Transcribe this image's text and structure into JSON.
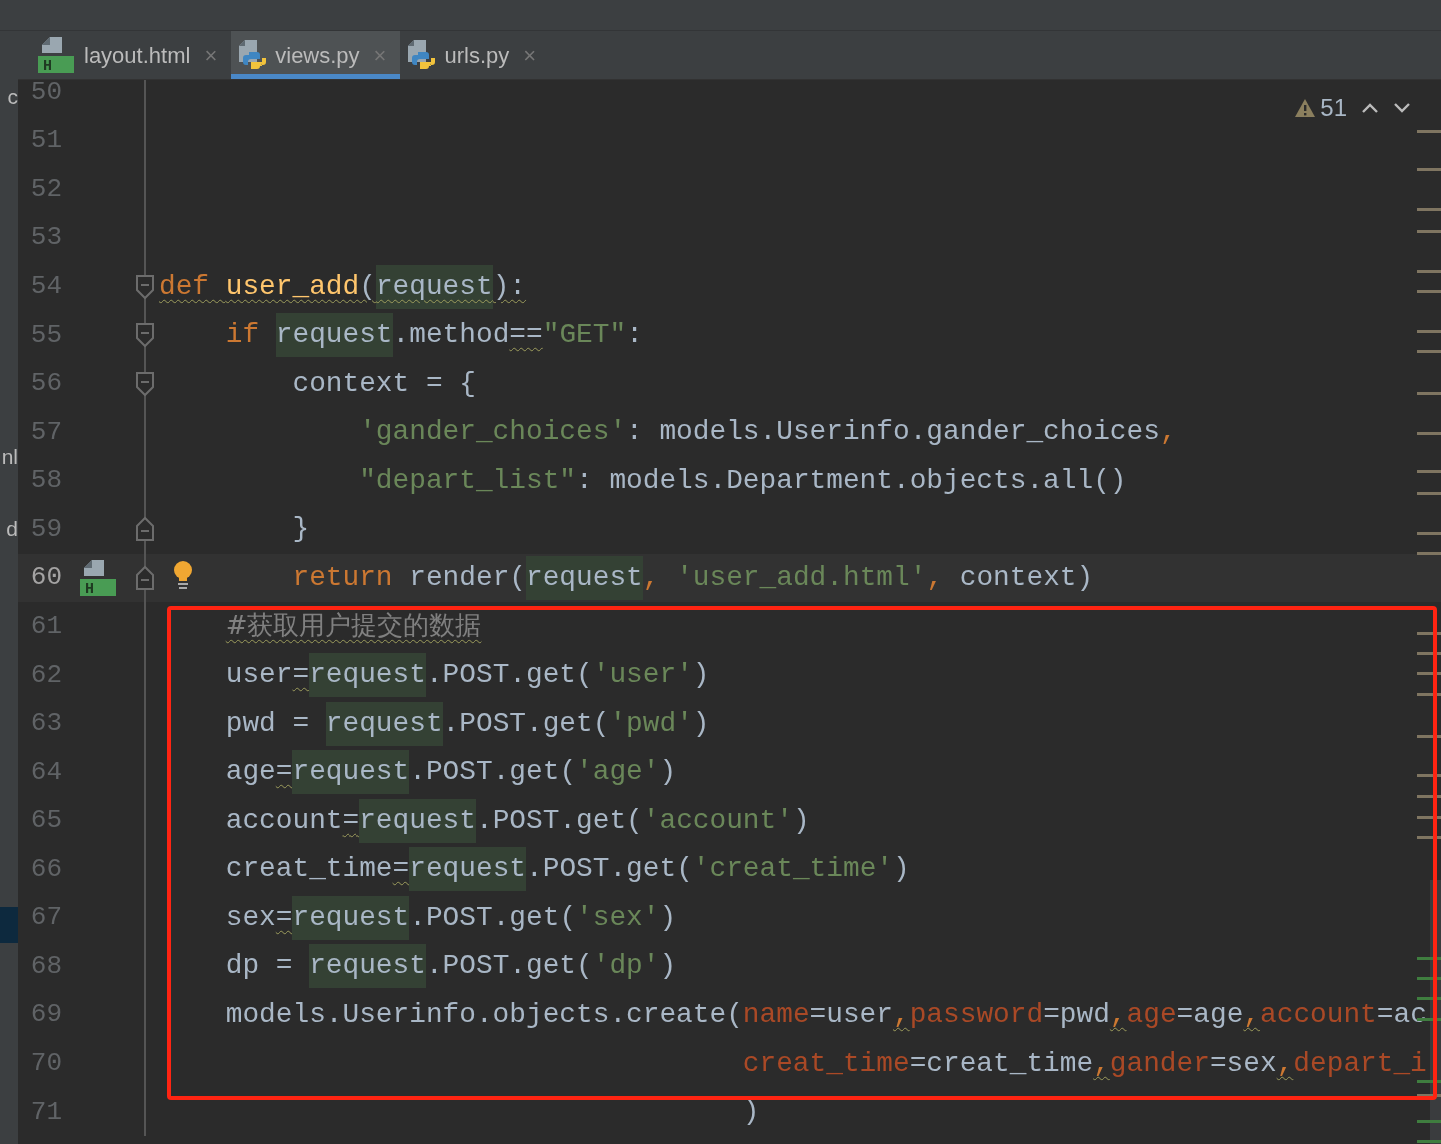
{
  "project_panel": {
    "fragments": [
      "c",
      "nl",
      "d"
    ],
    "selected_row": true
  },
  "tabs": [
    {
      "label": "layout.html",
      "kind": "html",
      "icon_label": "H",
      "close": "×",
      "selected": false
    },
    {
      "label": "views.py",
      "kind": "python",
      "close": "×",
      "selected": true
    },
    {
      "label": "urls.py",
      "kind": "python",
      "close": "×",
      "selected": false
    }
  ],
  "inspections": {
    "warnings": "51"
  },
  "editor": {
    "lines": [
      {
        "number": "50",
        "current": false,
        "fold_start": false,
        "fold_end": false
      },
      {
        "number": "51",
        "current": false,
        "fold_start": false,
        "fold_end": false
      },
      {
        "number": "52",
        "current": false,
        "fold_start": false,
        "fold_end": false
      },
      {
        "number": "53",
        "current": false,
        "fold_start": false,
        "fold_end": false
      },
      {
        "number": "54",
        "current": false,
        "fold_start": true,
        "fold_end": false,
        "tokens": [
          {
            "text": "def ",
            "kind": "kw",
            "warn": true,
            "usage": false
          },
          {
            "text": "user_add",
            "kind": "fn",
            "warn": true,
            "usage": false
          },
          {
            "text": "(",
            "kind": "plain",
            "warn": true,
            "usage": false
          },
          {
            "text": "request",
            "kind": "plain",
            "usage": true,
            "warn": true
          },
          {
            "text": "):",
            "kind": "plain",
            "warn": true,
            "usage": false
          }
        ]
      },
      {
        "number": "55",
        "current": false,
        "fold_start": true,
        "fold_end": false,
        "tokens": [
          {
            "text": "    if ",
            "kind": "kw",
            "warn": false,
            "usage": false
          },
          {
            "text": "request",
            "kind": "plain",
            "usage": true,
            "warn": false
          },
          {
            "text": ".method",
            "kind": "plain",
            "warn": false,
            "usage": false
          },
          {
            "text": "==",
            "kind": "plain",
            "warn": true,
            "usage": false
          },
          {
            "text": "\"GET\"",
            "kind": "str",
            "warn": false,
            "usage": false
          },
          {
            "text": ":",
            "kind": "plain",
            "warn": false,
            "usage": false
          }
        ]
      },
      {
        "number": "56",
        "current": false,
        "fold_start": true,
        "fold_end": false,
        "tokens": [
          {
            "text": "        context = {",
            "kind": "plain",
            "warn": false,
            "usage": false
          }
        ]
      },
      {
        "number": "57",
        "current": false,
        "fold_start": false,
        "fold_end": false,
        "tokens": [
          {
            "text": "            'gander_choices'",
            "kind": "str",
            "warn": false,
            "usage": false
          },
          {
            "text": ": models.Userinfo.gander_choices",
            "kind": "plain",
            "warn": false,
            "usage": false
          },
          {
            "text": ",",
            "kind": "kw",
            "warn": false,
            "usage": false
          }
        ]
      },
      {
        "number": "58",
        "current": false,
        "fold_start": false,
        "fold_end": false,
        "tokens": [
          {
            "text": "            \"depart_list\"",
            "kind": "str",
            "warn": false,
            "usage": false
          },
          {
            "text": ": models.Department.objects.all()",
            "kind": "plain",
            "warn": false,
            "usage": false
          }
        ]
      },
      {
        "number": "59",
        "current": false,
        "fold_start": false,
        "fold_end": true,
        "tokens": [
          {
            "text": "        }",
            "kind": "plain",
            "warn": false,
            "usage": false
          }
        ]
      },
      {
        "number": "60",
        "current": true,
        "fold_start": false,
        "fold_end": true,
        "marker": {
          "kind": "html",
          "label": "H"
        },
        "bulb": true,
        "tokens": [
          {
            "text": "        return",
            "kind": "kw",
            "warn": false,
            "usage": false
          },
          {
            "text": " render(",
            "kind": "plain",
            "warn": false,
            "usage": false
          },
          {
            "text": "request",
            "kind": "plain",
            "usage": true,
            "warn": false
          },
          {
            "text": ",",
            "kind": "kw",
            "warn": false,
            "usage": false
          },
          {
            "text": " 'user_add.html'",
            "kind": "str",
            "warn": false,
            "usage": false
          },
          {
            "text": ",",
            "kind": "kw",
            "warn": false,
            "usage": false
          },
          {
            "text": " context)",
            "kind": "plain",
            "warn": false,
            "usage": false
          }
        ]
      },
      {
        "number": "61",
        "current": false,
        "fold_start": false,
        "fold_end": false,
        "indent": true,
        "tokens": [
          {
            "text": "#获取用户提交的数据",
            "kind": "cm",
            "warn": true,
            "usage": false
          }
        ]
      },
      {
        "number": "62",
        "current": false,
        "fold_start": false,
        "fold_end": false,
        "tokens": [
          {
            "text": "    user",
            "kind": "plain",
            "warn": false,
            "usage": false
          },
          {
            "text": "=",
            "kind": "plain",
            "warn": true,
            "usage": false
          },
          {
            "text": "request",
            "kind": "plain",
            "usage": true,
            "warn": false
          },
          {
            "text": ".POST.get(",
            "kind": "plain",
            "warn": false,
            "usage": false
          },
          {
            "text": "'user'",
            "kind": "str",
            "warn": false,
            "usage": false
          },
          {
            "text": ")",
            "kind": "plain",
            "warn": false,
            "usage": false
          }
        ]
      },
      {
        "number": "63",
        "current": false,
        "fold_start": false,
        "fold_end": false,
        "tokens": [
          {
            "text": "    pwd = ",
            "kind": "plain",
            "warn": false,
            "usage": false
          },
          {
            "text": "request",
            "kind": "plain",
            "usage": true,
            "warn": false
          },
          {
            "text": ".POST.get(",
            "kind": "plain",
            "warn": false,
            "usage": false
          },
          {
            "text": "'pwd'",
            "kind": "str",
            "warn": false,
            "usage": false
          },
          {
            "text": ")",
            "kind": "plain",
            "warn": false,
            "usage": false
          }
        ]
      },
      {
        "number": "64",
        "current": false,
        "fold_start": false,
        "fold_end": false,
        "tokens": [
          {
            "text": "    age",
            "kind": "plain",
            "warn": false,
            "usage": false
          },
          {
            "text": "=",
            "kind": "plain",
            "warn": true,
            "usage": false
          },
          {
            "text": "request",
            "kind": "plain",
            "usage": true,
            "warn": false
          },
          {
            "text": ".POST.get(",
            "kind": "plain",
            "warn": false,
            "usage": false
          },
          {
            "text": "'age'",
            "kind": "str",
            "warn": false,
            "usage": false
          },
          {
            "text": ")",
            "kind": "plain",
            "warn": false,
            "usage": false
          }
        ]
      },
      {
        "number": "65",
        "current": false,
        "fold_start": false,
        "fold_end": false,
        "tokens": [
          {
            "text": "    account",
            "kind": "plain",
            "warn": false,
            "usage": false
          },
          {
            "text": "=",
            "kind": "plain",
            "warn": true,
            "usage": false
          },
          {
            "text": "request",
            "kind": "plain",
            "usage": true,
            "warn": false
          },
          {
            "text": ".POST.get(",
            "kind": "plain",
            "warn": false,
            "usage": false
          },
          {
            "text": "'account'",
            "kind": "str",
            "warn": false,
            "usage": false
          },
          {
            "text": ")",
            "kind": "plain",
            "warn": false,
            "usage": false
          }
        ]
      },
      {
        "number": "66",
        "current": false,
        "fold_start": false,
        "fold_end": false,
        "tokens": [
          {
            "text": "    creat_time",
            "kind": "plain",
            "warn": false,
            "usage": false
          },
          {
            "text": "=",
            "kind": "plain",
            "warn": true,
            "usage": false
          },
          {
            "text": "request",
            "kind": "plain",
            "usage": true,
            "warn": false
          },
          {
            "text": ".POST.get(",
            "kind": "plain",
            "warn": false,
            "usage": false
          },
          {
            "text": "'creat_time'",
            "kind": "str",
            "warn": false,
            "usage": false
          },
          {
            "text": ")",
            "kind": "plain",
            "warn": false,
            "usage": false
          }
        ]
      },
      {
        "number": "67",
        "current": false,
        "fold_start": false,
        "fold_end": false,
        "tokens": [
          {
            "text": "    sex",
            "kind": "plain",
            "warn": false,
            "usage": false
          },
          {
            "text": "=",
            "kind": "plain",
            "warn": true,
            "usage": false
          },
          {
            "text": "request",
            "kind": "plain",
            "usage": true,
            "warn": false
          },
          {
            "text": ".POST.get(",
            "kind": "plain",
            "warn": false,
            "usage": false
          },
          {
            "text": "'sex'",
            "kind": "str",
            "warn": false,
            "usage": false
          },
          {
            "text": ")",
            "kind": "plain",
            "warn": false,
            "usage": false
          }
        ]
      },
      {
        "number": "68",
        "current": false,
        "fold_start": false,
        "fold_end": false,
        "tokens": [
          {
            "text": "    dp = ",
            "kind": "plain",
            "warn": false,
            "usage": false
          },
          {
            "text": "request",
            "kind": "plain",
            "usage": true,
            "warn": false
          },
          {
            "text": ".POST.get(",
            "kind": "plain",
            "warn": false,
            "usage": false
          },
          {
            "text": "'dp'",
            "kind": "str",
            "warn": false,
            "usage": false
          },
          {
            "text": ")",
            "kind": "plain",
            "warn": false,
            "usage": false
          }
        ]
      },
      {
        "number": "69",
        "current": false,
        "fold_start": false,
        "fold_end": false,
        "tokens": [
          {
            "text": "    models.Userinfo.objects.create(",
            "kind": "plain",
            "warn": false,
            "usage": false
          },
          {
            "text": "name",
            "kind": "arg",
            "warn": false,
            "usage": false
          },
          {
            "text": "=user",
            "kind": "plain",
            "warn": false,
            "usage": false
          },
          {
            "text": ",",
            "kind": "kw",
            "warn": true,
            "usage": false
          },
          {
            "text": "password",
            "kind": "arg",
            "warn": false,
            "usage": false
          },
          {
            "text": "=pwd",
            "kind": "plain",
            "warn": false,
            "usage": false
          },
          {
            "text": ",",
            "kind": "kw",
            "warn": true,
            "usage": false
          },
          {
            "text": "age",
            "kind": "arg",
            "warn": false,
            "usage": false
          },
          {
            "text": "=age",
            "kind": "plain",
            "warn": false,
            "usage": false
          },
          {
            "text": ",",
            "kind": "kw",
            "warn": true,
            "usage": false
          },
          {
            "text": "account",
            "kind": "arg",
            "warn": false,
            "usage": false
          },
          {
            "text": "=ac",
            "kind": "plain",
            "warn": false,
            "usage": false
          }
        ]
      },
      {
        "number": "70",
        "current": false,
        "fold_start": false,
        "fold_end": false,
        "tokens": [
          {
            "text": "                                   creat_time",
            "kind": "arg",
            "warn": false,
            "usage": false
          },
          {
            "text": "=creat_time",
            "kind": "plain",
            "warn": false,
            "usage": false
          },
          {
            "text": ",",
            "kind": "kw",
            "warn": true,
            "usage": false
          },
          {
            "text": "gander",
            "kind": "arg",
            "warn": false,
            "usage": false
          },
          {
            "text": "=sex",
            "kind": "plain",
            "warn": false,
            "usage": false
          },
          {
            "text": ",",
            "kind": "kw",
            "warn": true,
            "usage": false
          },
          {
            "text": "depart_i",
            "kind": "arg",
            "warn": false,
            "usage": false
          }
        ]
      },
      {
        "number": "71",
        "current": false,
        "fold_start": false,
        "fold_end": false,
        "tokens": [
          {
            "text": "                                   )",
            "kind": "plain",
            "warn": false,
            "usage": false
          }
        ]
      }
    ]
  }
}
